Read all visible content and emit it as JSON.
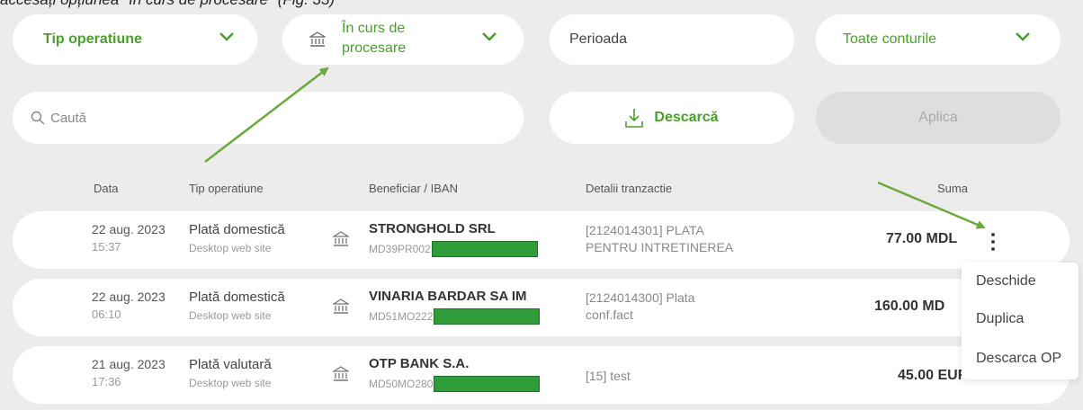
{
  "caption": "accesați opțiunea \"În curs de procesare\" (Fig. 33)",
  "filters": {
    "type_label": "Tip operatiune",
    "status_label_line1": "În curs de",
    "status_label_line2": "procesare",
    "period_label": "Perioada",
    "accounts_label": "Toate conturile"
  },
  "search": {
    "placeholder": "Caută"
  },
  "actions": {
    "download_label": "Descarcă",
    "apply_label": "Aplica"
  },
  "columns": {
    "date": "Data",
    "type": "Tip operatiune",
    "beneficiary": "Beneficiar / IBAN",
    "details": "Detalii tranzactie",
    "amount": "Suma"
  },
  "rows": [
    {
      "date": "22 aug. 2023",
      "time": "15:37",
      "type": "Plată domestică",
      "channel": "Desktop web site",
      "beneficiary": "STRONGHOLD SRL",
      "iban_prefix": "MD39PR002",
      "details_line1": "[2124014301] PLATA",
      "details_line2": "PENTRU INTRETINEREA",
      "amount": "77.00 MDL"
    },
    {
      "date": "22 aug. 2023",
      "time": "06:10",
      "type": "Plată domestică",
      "channel": "Desktop web site",
      "beneficiary": "VINARIA BARDAR SA IM",
      "iban_prefix": "MD51MO222",
      "details_line1": "[2124014300] Plata",
      "details_line2": "conf.fact",
      "amount": "160.00 MD"
    },
    {
      "date": "21 aug. 2023",
      "time": "17:36",
      "type": "Plată valutară",
      "channel": "Desktop web site",
      "beneficiary": "OTP BANK S.A.",
      "iban_prefix": "MD50MO280",
      "details_line1": "[15] test",
      "details_line2": "",
      "amount": "45.00 EUR"
    }
  ],
  "context_menu": {
    "open": "Deschide",
    "duplicate": "Duplica",
    "download_op": "Descarca OP"
  },
  "colors": {
    "accent": "#4a9f2c",
    "arrow": "#6aaa3a",
    "redaction": "#2f9e3a"
  },
  "icons": [
    "chevron-down-icon",
    "bank-icon",
    "search-icon",
    "download-icon",
    "kebab-menu-icon"
  ]
}
